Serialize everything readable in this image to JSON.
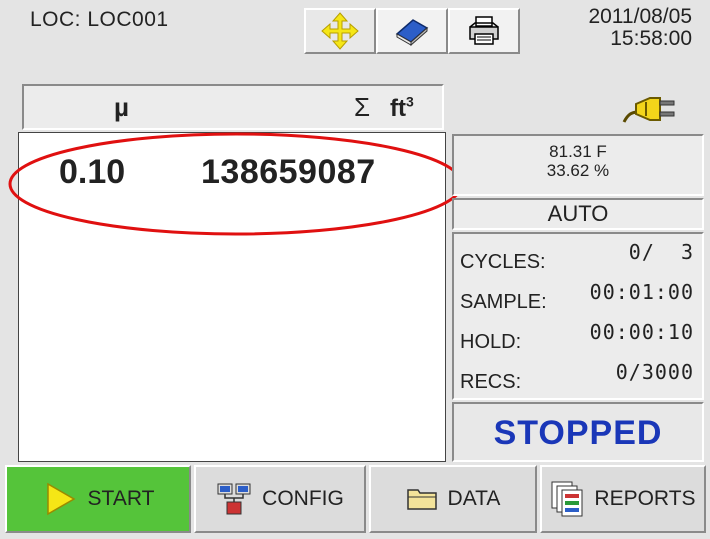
{
  "header": {
    "location": "LOC: LOC001",
    "date": "2011/08/05",
    "time": "15:58:00"
  },
  "toolbar": {
    "icons": [
      "move-arrows-icon",
      "book-icon",
      "printer-icon"
    ],
    "power_icon": "power-plug-icon"
  },
  "columns": {
    "mu": "µ",
    "sum": "Σ",
    "unit": "ft",
    "unit_exp": "3"
  },
  "reading": {
    "mu": "0.10",
    "sum": "138659087"
  },
  "environment": {
    "temperature": "81.31 F",
    "humidity": "33.62 %"
  },
  "mode": "AUTO",
  "stats": [
    {
      "label": "CYCLES:",
      "value": "0/  3"
    },
    {
      "label": "SAMPLE:",
      "value": "00:01:00"
    },
    {
      "label": "HOLD:",
      "value": "00:00:10"
    },
    {
      "label": "RECS:",
      "value": "0/3000"
    }
  ],
  "status": "STOPPED",
  "buttons": {
    "start": "START",
    "config": "CONFIG",
    "data": "DATA",
    "reports": "REPORTS"
  },
  "colors": {
    "status_text": "#1a37b8",
    "start_button": "#55c43a",
    "annotation_circle": "#e01010"
  }
}
